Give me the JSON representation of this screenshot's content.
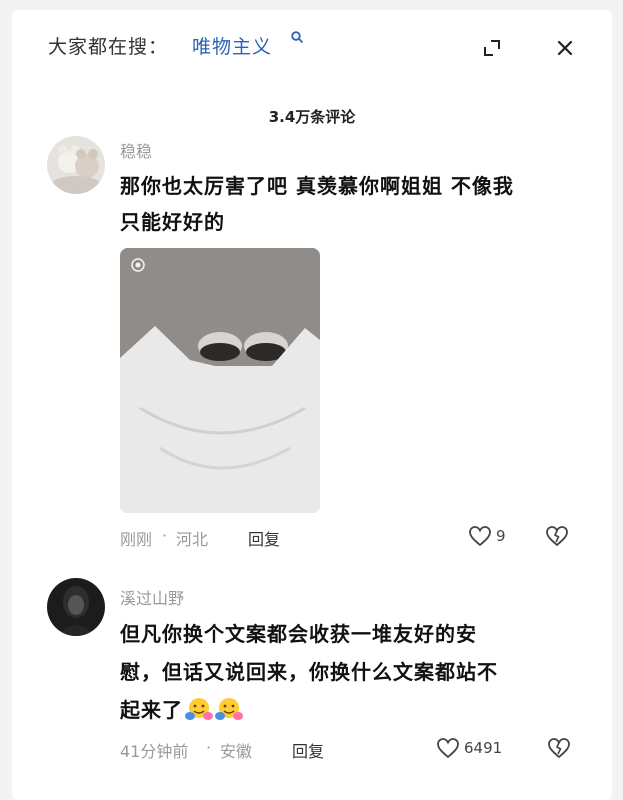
{
  "header": {
    "search_prefix": "大家都在搜：",
    "search_term": "唯物主义",
    "search_icon": "search-icon",
    "expand_icon": "expand-icon",
    "close_icon": "close-icon"
  },
  "comments_count": "3.4万条评论",
  "comments": [
    {
      "username": "稳稳",
      "text_line1": "那你也太厉害了吧 真羡慕你啊姐姐 不像我",
      "text_line2": "只能好好的",
      "time": "刚刚",
      "location": "河北",
      "reply_label": "回复",
      "likes": "9"
    },
    {
      "username": "溪过山野",
      "text_line1": "但凡你换个文案都会收获一堆友好的安",
      "text_line2": "慰，但话又说回来，你换什么文案都站不",
      "text_line3": "起来了",
      "time": "41分钟前",
      "location": "安徽",
      "reply_label": "回复",
      "likes": "6491"
    }
  ],
  "colors": {
    "accent": "#2a63b8",
    "meta": "#9a9a9a"
  }
}
